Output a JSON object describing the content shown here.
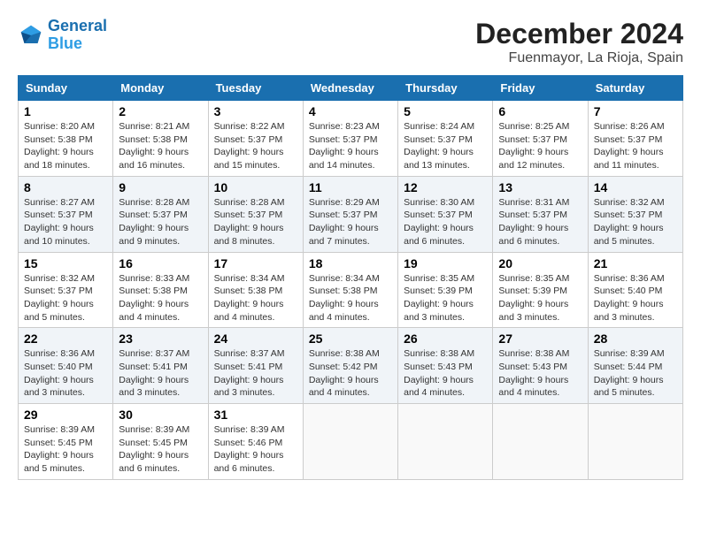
{
  "header": {
    "logo_line1": "General",
    "logo_line2": "Blue",
    "month": "December 2024",
    "location": "Fuenmayor, La Rioja, Spain"
  },
  "weekdays": [
    "Sunday",
    "Monday",
    "Tuesday",
    "Wednesday",
    "Thursday",
    "Friday",
    "Saturday"
  ],
  "weeks": [
    [
      {
        "day": "1",
        "sunrise": "8:20 AM",
        "sunset": "5:38 PM",
        "daylight": "9 hours and 18 minutes."
      },
      {
        "day": "2",
        "sunrise": "8:21 AM",
        "sunset": "5:38 PM",
        "daylight": "9 hours and 16 minutes."
      },
      {
        "day": "3",
        "sunrise": "8:22 AM",
        "sunset": "5:37 PM",
        "daylight": "9 hours and 15 minutes."
      },
      {
        "day": "4",
        "sunrise": "8:23 AM",
        "sunset": "5:37 PM",
        "daylight": "9 hours and 14 minutes."
      },
      {
        "day": "5",
        "sunrise": "8:24 AM",
        "sunset": "5:37 PM",
        "daylight": "9 hours and 13 minutes."
      },
      {
        "day": "6",
        "sunrise": "8:25 AM",
        "sunset": "5:37 PM",
        "daylight": "9 hours and 12 minutes."
      },
      {
        "day": "7",
        "sunrise": "8:26 AM",
        "sunset": "5:37 PM",
        "daylight": "9 hours and 11 minutes."
      }
    ],
    [
      {
        "day": "8",
        "sunrise": "8:27 AM",
        "sunset": "5:37 PM",
        "daylight": "9 hours and 10 minutes."
      },
      {
        "day": "9",
        "sunrise": "8:28 AM",
        "sunset": "5:37 PM",
        "daylight": "9 hours and 9 minutes."
      },
      {
        "day": "10",
        "sunrise": "8:28 AM",
        "sunset": "5:37 PM",
        "daylight": "9 hours and 8 minutes."
      },
      {
        "day": "11",
        "sunrise": "8:29 AM",
        "sunset": "5:37 PM",
        "daylight": "9 hours and 7 minutes."
      },
      {
        "day": "12",
        "sunrise": "8:30 AM",
        "sunset": "5:37 PM",
        "daylight": "9 hours and 6 minutes."
      },
      {
        "day": "13",
        "sunrise": "8:31 AM",
        "sunset": "5:37 PM",
        "daylight": "9 hours and 6 minutes."
      },
      {
        "day": "14",
        "sunrise": "8:32 AM",
        "sunset": "5:37 PM",
        "daylight": "9 hours and 5 minutes."
      }
    ],
    [
      {
        "day": "15",
        "sunrise": "8:32 AM",
        "sunset": "5:37 PM",
        "daylight": "9 hours and 5 minutes."
      },
      {
        "day": "16",
        "sunrise": "8:33 AM",
        "sunset": "5:38 PM",
        "daylight": "9 hours and 4 minutes."
      },
      {
        "day": "17",
        "sunrise": "8:34 AM",
        "sunset": "5:38 PM",
        "daylight": "9 hours and 4 minutes."
      },
      {
        "day": "18",
        "sunrise": "8:34 AM",
        "sunset": "5:38 PM",
        "daylight": "9 hours and 4 minutes."
      },
      {
        "day": "19",
        "sunrise": "8:35 AM",
        "sunset": "5:39 PM",
        "daylight": "9 hours and 3 minutes."
      },
      {
        "day": "20",
        "sunrise": "8:35 AM",
        "sunset": "5:39 PM",
        "daylight": "9 hours and 3 minutes."
      },
      {
        "day": "21",
        "sunrise": "8:36 AM",
        "sunset": "5:40 PM",
        "daylight": "9 hours and 3 minutes."
      }
    ],
    [
      {
        "day": "22",
        "sunrise": "8:36 AM",
        "sunset": "5:40 PM",
        "daylight": "9 hours and 3 minutes."
      },
      {
        "day": "23",
        "sunrise": "8:37 AM",
        "sunset": "5:41 PM",
        "daylight": "9 hours and 3 minutes."
      },
      {
        "day": "24",
        "sunrise": "8:37 AM",
        "sunset": "5:41 PM",
        "daylight": "9 hours and 3 minutes."
      },
      {
        "day": "25",
        "sunrise": "8:38 AM",
        "sunset": "5:42 PM",
        "daylight": "9 hours and 4 minutes."
      },
      {
        "day": "26",
        "sunrise": "8:38 AM",
        "sunset": "5:43 PM",
        "daylight": "9 hours and 4 minutes."
      },
      {
        "day": "27",
        "sunrise": "8:38 AM",
        "sunset": "5:43 PM",
        "daylight": "9 hours and 4 minutes."
      },
      {
        "day": "28",
        "sunrise": "8:39 AM",
        "sunset": "5:44 PM",
        "daylight": "9 hours and 5 minutes."
      }
    ],
    [
      {
        "day": "29",
        "sunrise": "8:39 AM",
        "sunset": "5:45 PM",
        "daylight": "9 hours and 5 minutes."
      },
      {
        "day": "30",
        "sunrise": "8:39 AM",
        "sunset": "5:45 PM",
        "daylight": "9 hours and 6 minutes."
      },
      {
        "day": "31",
        "sunrise": "8:39 AM",
        "sunset": "5:46 PM",
        "daylight": "9 hours and 6 minutes."
      },
      null,
      null,
      null,
      null
    ]
  ]
}
